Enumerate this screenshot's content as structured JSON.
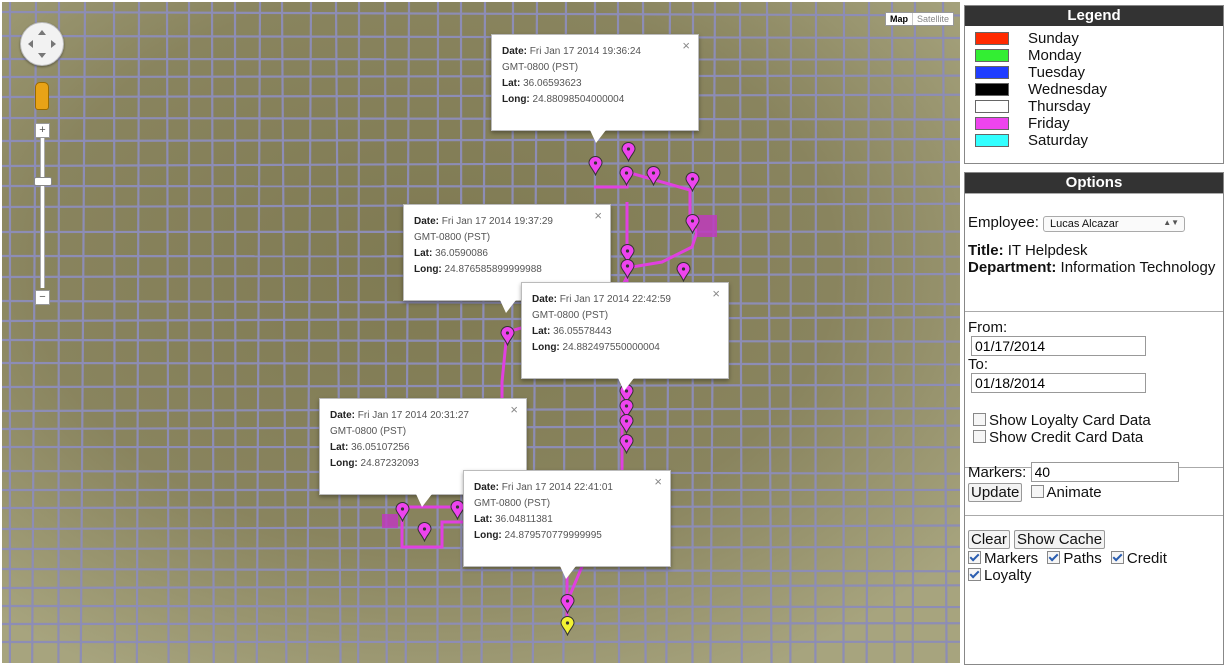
{
  "map": {
    "type_buttons": {
      "map": "Map",
      "satellite": "Satellite"
    },
    "zoom_in": "+",
    "zoom_out": "−",
    "popups": [
      {
        "date_label": "Date:",
        "date": "Fri Jan 17 2014 19:36:24",
        "tz": "GMT-0800 (PST)",
        "lat_label": "Lat:",
        "lat": "36.06593623",
        "long_label": "Long:",
        "long": "24.88098504000004",
        "close": "×"
      },
      {
        "date_label": "Date:",
        "date": "Fri Jan 17 2014 19:37:29",
        "tz": "GMT-0800 (PST)",
        "lat_label": "Lat:",
        "lat": "36.0590086",
        "long_label": "Long:",
        "long": "24.876585899999988",
        "close": "×"
      },
      {
        "date_label": "Date:",
        "date": "Fri Jan 17 2014 22:42:59",
        "tz": "GMT-0800 (PST)",
        "lat_label": "Lat:",
        "lat": "36.05578443",
        "long_label": "Long:",
        "long": "24.882497550000004",
        "close": "×"
      },
      {
        "date_label": "Date:",
        "date": "Fri Jan 17 2014 20:31:27",
        "tz": "GMT-0800 (PST)",
        "lat_label": "Lat:",
        "lat": "36.05107256",
        "long_label": "Long:",
        "long": "24.87232093",
        "close": "×"
      },
      {
        "date_label": "Date:",
        "date": "Fri Jan 17 2014 22:41:01",
        "tz": "GMT-0800 (PST)",
        "lat_label": "Lat:",
        "lat": "36.04811381",
        "long_label": "Long:",
        "long": "24.879570779999995",
        "close": "×"
      }
    ],
    "colors": {
      "background": "#8a8460",
      "roads": "#8d8db5",
      "path": "#e040e0",
      "marker_friday": "#ee44ee",
      "marker_current": "#f2f233"
    }
  },
  "legend": {
    "title": "Legend",
    "items": [
      {
        "label": "Sunday",
        "color": "#ff2a00"
      },
      {
        "label": "Monday",
        "color": "#33ee33"
      },
      {
        "label": "Tuesday",
        "color": "#1f3dff"
      },
      {
        "label": "Wednesday",
        "color": "#000000"
      },
      {
        "label": "Thursday",
        "color": "#ffffff"
      },
      {
        "label": "Friday",
        "color": "#ee44ee"
      },
      {
        "label": "Saturday",
        "color": "#33ffff"
      }
    ]
  },
  "options": {
    "title": "Options",
    "employee_label": "Employee:",
    "employee_value": "Lucas Alcazar",
    "title_label": "Title:",
    "title_value": "IT Helpdesk",
    "department_label": "Department:",
    "department_value": "Information Technology",
    "from_label": "From:",
    "from_value": "01/17/2014",
    "to_label": "To:",
    "to_value": "01/18/2014",
    "show_loyalty": "Show Loyalty Card Data",
    "show_credit": "Show Credit Card Data",
    "markers_label": "Markers:",
    "markers_value": "40",
    "update_button": "Update",
    "animate_label": "Animate",
    "clear_button": "Clear",
    "show_cache_button": "Show Cache",
    "toggles": {
      "markers": "Markers",
      "paths": "Paths",
      "credit": "Credit",
      "loyalty": "Loyalty"
    }
  }
}
